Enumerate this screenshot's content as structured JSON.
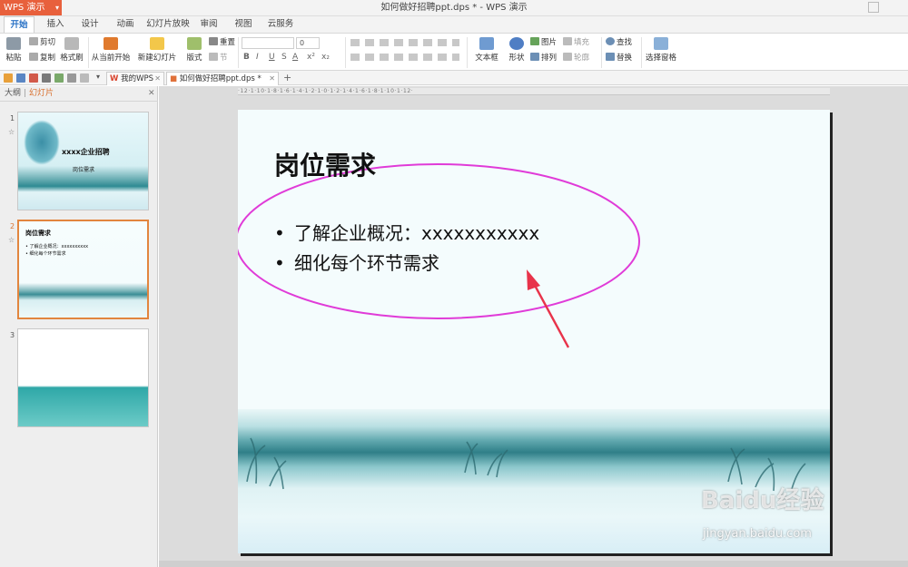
{
  "titlebar": {
    "app_menu": "WPS 演示",
    "doc_title": "如何做好招聘ppt.dps * - WPS 演示"
  },
  "ribbon_tabs": [
    "开始",
    "插入",
    "设计",
    "动画",
    "幻灯片放映",
    "审阅",
    "视图",
    "云服务"
  ],
  "ribbon": {
    "paste": "粘贴",
    "cut": "剪切",
    "copy": "复制",
    "format_painter": "格式刷",
    "from_current": "从当前开始",
    "new_slide": "新建幻灯片",
    "layout": "版式",
    "reset": "重置",
    "section": "节",
    "font_size": "0",
    "textbox": "文本框",
    "shape": "形状",
    "picture": "图片",
    "fill": "填充",
    "arrange": "排列",
    "outline": "轮廓",
    "find": "查找",
    "replace": "替换",
    "select_pane": "选择窗格"
  },
  "doc_tabs": {
    "home": "我的WPS",
    "active_doc": "如何做好招聘ppt.dps *",
    "add": "+"
  },
  "left_panel": {
    "tab_outline": "大纲",
    "tab_slides": "幻灯片",
    "slides": [
      {
        "num": "1",
        "title": "xxxx企业招聘",
        "subtitle": "岗位需求"
      },
      {
        "num": "2",
        "title": "岗位需求",
        "line1": "• 了解企业概况：xxxxxxxxxx",
        "line2": "• 细化每个环节需求"
      },
      {
        "num": "3"
      }
    ]
  },
  "slide": {
    "title": "岗位需求",
    "bullets": [
      "了解企业概况：xxxxxxxxxxx",
      "细化每个环节需求"
    ],
    "annotation_color": "#e03bd8",
    "arrow_color": "#e8334a"
  },
  "watermark": {
    "logo": "Baidu经验",
    "url": "jingyan.baidu.com"
  },
  "ruler_text": "·12·1·10·1·8·1·6·1·4·1·2·1·0·1·2·1·4·1·6·1·8·1·10·1·12·"
}
